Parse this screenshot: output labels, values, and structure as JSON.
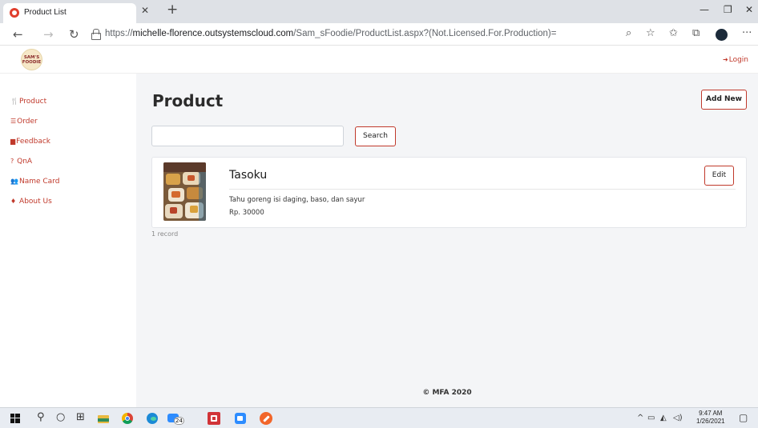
{
  "browser": {
    "tab_title": "Product List",
    "url_scheme": "https://",
    "url_host": "michelle-florence.outsystemscloud.com",
    "url_path": "/Sam_sFoodie/ProductList.aspx?(Not.Licensed.For.Production)="
  },
  "app": {
    "logo_text": "SAM'S FOODIE",
    "login_label": "Login",
    "accent_color": "#c0392b"
  },
  "sidebar": {
    "items": [
      {
        "label": "Product",
        "icon": "cutlery-icon"
      },
      {
        "label": "Order",
        "icon": "list-icon"
      },
      {
        "label": "Feedback",
        "icon": "comment-icon"
      },
      {
        "label": "QnA",
        "icon": "question-icon"
      },
      {
        "label": "Name Card",
        "icon": "users-icon"
      },
      {
        "label": "About Us",
        "icon": "person-icon"
      }
    ]
  },
  "main": {
    "title": "Product",
    "add_new_label": "Add New",
    "search": {
      "value": "",
      "placeholder": "",
      "button_label": "Search"
    },
    "products": [
      {
        "name": "Tasoku",
        "description": "Tahu goreng isi daging, baso, dan sayur",
        "price": "Rp. 30000",
        "edit_label": "Edit"
      }
    ],
    "record_count": "1 record",
    "footer": "© MFA 2020"
  },
  "taskbar": {
    "badge": "24",
    "time": "9:47 AM",
    "date": "1/26/2021"
  }
}
